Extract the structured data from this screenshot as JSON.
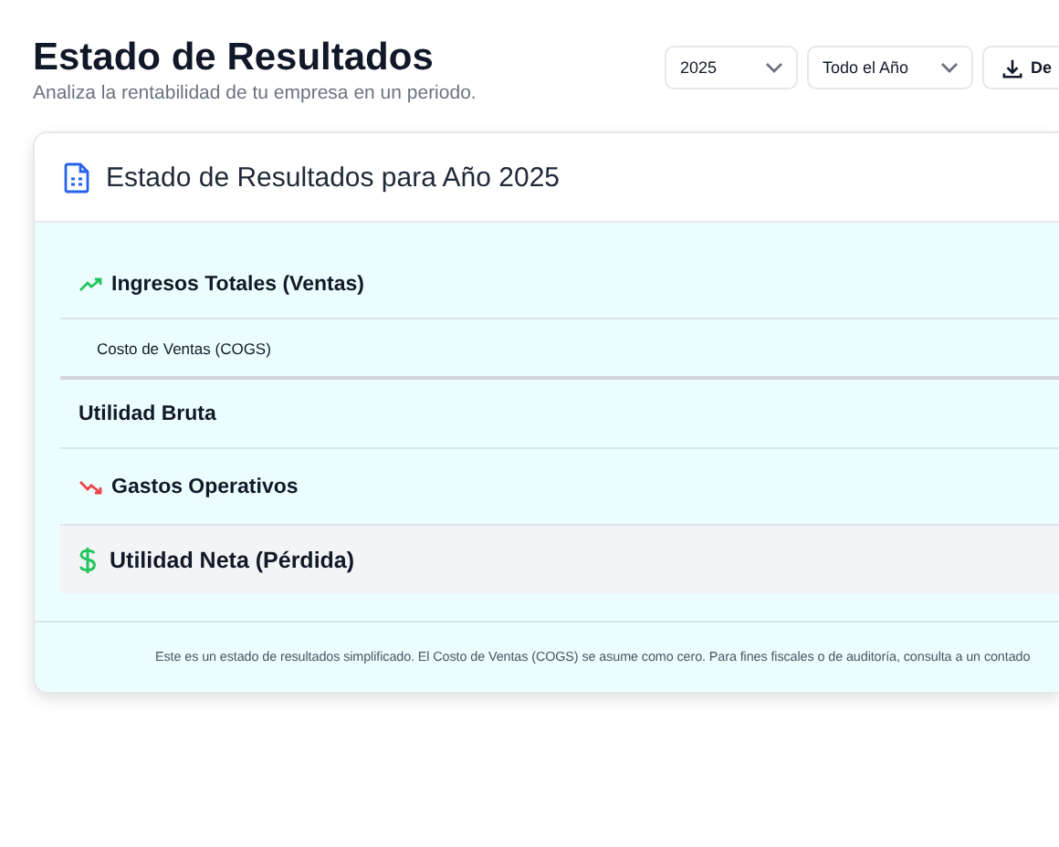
{
  "header": {
    "title": "Estado de Resultados",
    "subtitle": "Analiza la rentabilidad de tu empresa en un periodo."
  },
  "filters": [
    {
      "value": "2025"
    },
    {
      "value": "Todo el Año"
    }
  ],
  "export_button": {
    "label": "De"
  },
  "card": {
    "title": "Estado de Resultados para Año 2025",
    "rows": [
      {
        "kind": "income",
        "label": "Ingresos Totales (Ventas)"
      },
      {
        "kind": "cost",
        "label": "Costo de Ventas (COGS)"
      },
      {
        "kind": "subtotal",
        "label": "Utilidad Bruta"
      },
      {
        "kind": "expense",
        "label": "Gastos Operativos"
      },
      {
        "kind": "net",
        "label": "Utilidad Neta (Pérdida)"
      }
    ],
    "footnote": "Este es un estado de resultados simplificado. El Costo de Ventas (COGS) se asume como cero. Para fines fiscales o de auditoría, consulta a un contado"
  }
}
